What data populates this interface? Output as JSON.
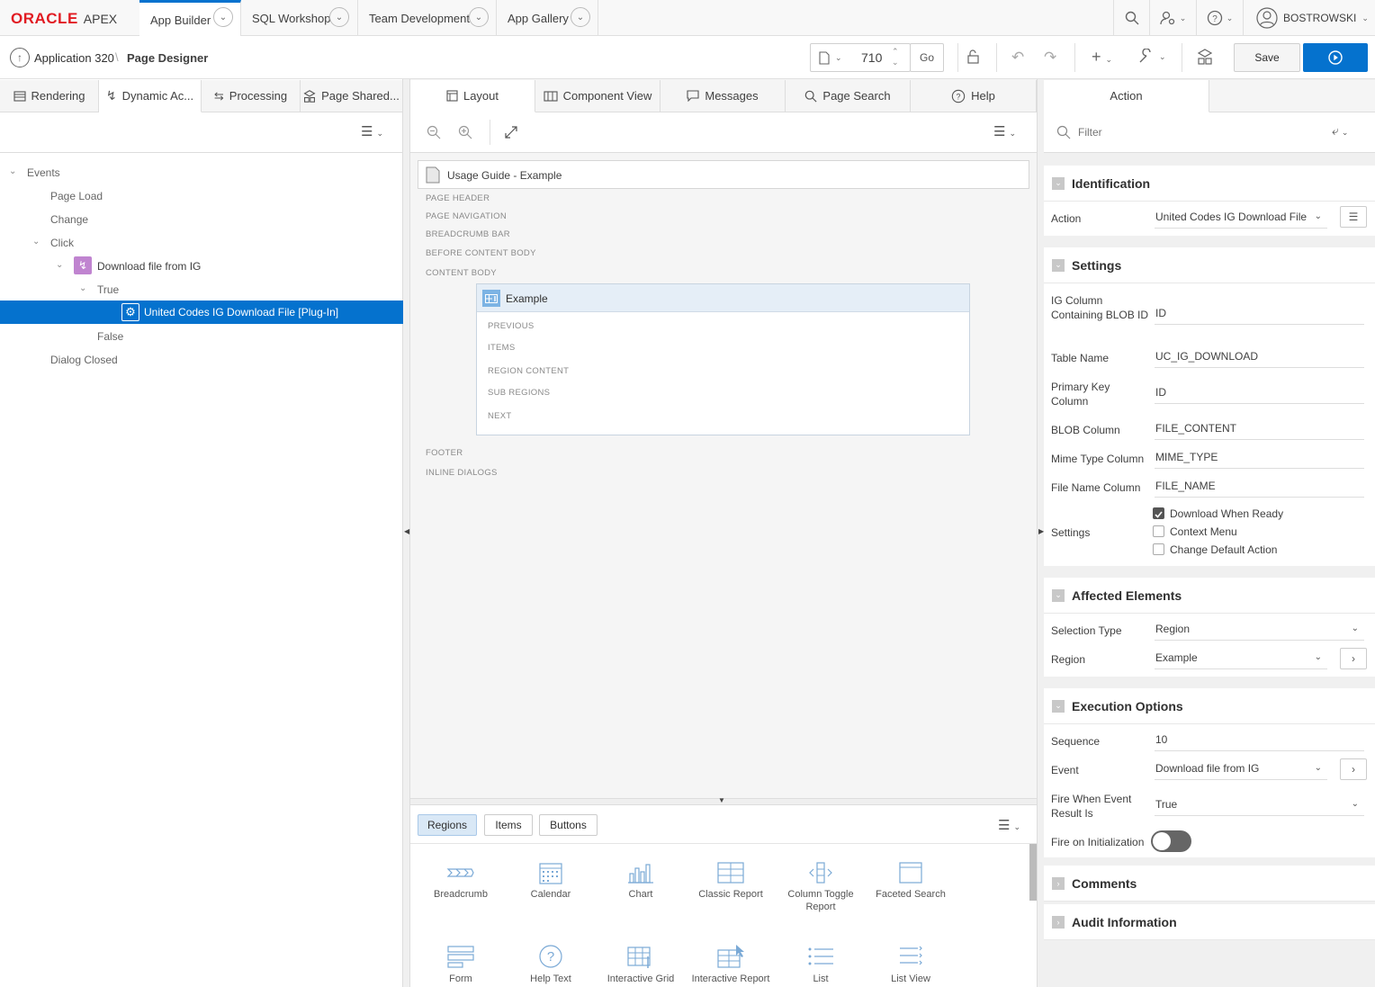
{
  "brand": {
    "oracle": "ORACLE",
    "apex": "APEX"
  },
  "nav": {
    "tabs": [
      "App Builder",
      "SQL Workshop",
      "Team Development",
      "App Gallery"
    ],
    "user": "BOSTROWSKI"
  },
  "toolbar": {
    "app": "Application 320",
    "page_designer": "Page Designer",
    "page_number": "710",
    "go": "Go",
    "save": "Save"
  },
  "left": {
    "tabs": [
      "Rendering",
      "Dynamic Ac...",
      "Processing",
      "Page Shared..."
    ],
    "tree": {
      "events": "Events",
      "page_load": "Page Load",
      "change": "Change",
      "click": "Click",
      "download": "Download file from IG",
      "true": "True",
      "plugin": "United Codes IG Download File [Plug-In]",
      "false": "False",
      "dialog_closed": "Dialog Closed"
    }
  },
  "center": {
    "tabs": [
      "Layout",
      "Component View",
      "Messages",
      "Page Search",
      "Help"
    ],
    "page_title": "Usage Guide - Example",
    "positions": [
      "PAGE HEADER",
      "PAGE NAVIGATION",
      "BREADCRUMB BAR",
      "BEFORE CONTENT BODY",
      "CONTENT BODY"
    ],
    "region": {
      "title": "Example",
      "slots": [
        "PREVIOUS",
        "ITEMS",
        "REGION CONTENT",
        "SUB REGIONS",
        "NEXT"
      ]
    },
    "positions_after": [
      "FOOTER",
      "INLINE DIALOGS"
    ],
    "gallery_tabs": [
      "Regions",
      "Items",
      "Buttons"
    ],
    "gallery": [
      {
        "label": "Breadcrumb",
        "icon": "breadcrumb-icon"
      },
      {
        "label": "Calendar",
        "icon": "calendar-icon"
      },
      {
        "label": "Chart",
        "icon": "chart-icon"
      },
      {
        "label": "Classic Report",
        "icon": "classic-report-icon"
      },
      {
        "label": "Column Toggle Report",
        "icon": "column-toggle-icon"
      },
      {
        "label": "Faceted Search",
        "icon": "faceted-search-icon"
      },
      {
        "label": "Form",
        "icon": "form-icon"
      },
      {
        "label": "Help Text",
        "icon": "help-text-icon"
      },
      {
        "label": "Interactive Grid",
        "icon": "interactive-grid-icon"
      },
      {
        "label": "Interactive Report",
        "icon": "interactive-report-icon"
      },
      {
        "label": "List",
        "icon": "list-icon"
      },
      {
        "label": "List View",
        "icon": "list-view-icon"
      }
    ]
  },
  "right": {
    "tab": "Action",
    "filter_placeholder": "Filter",
    "identification": {
      "title": "Identification",
      "action_label": "Action",
      "action_value": "United Codes IG Download File"
    },
    "settings": {
      "title": "Settings",
      "ig_column_label": "IG Column Containing BLOB ID",
      "ig_column_value": "ID",
      "table_label": "Table Name",
      "table_value": "UC_IG_DOWNLOAD",
      "pk_label": "Primary Key Column",
      "pk_value": "ID",
      "blob_label": "BLOB Column",
      "blob_value": "FILE_CONTENT",
      "mime_label": "Mime Type Column",
      "mime_value": "MIME_TYPE",
      "filename_label": "File Name Column",
      "filename_value": "FILE_NAME",
      "settings_label": "Settings",
      "opt1": "Download When Ready",
      "opt2": "Context Menu",
      "opt3": "Change Default Action"
    },
    "affected": {
      "title": "Affected Elements",
      "sel_label": "Selection Type",
      "sel_value": "Region",
      "region_label": "Region",
      "region_value": "Example"
    },
    "execution": {
      "title": "Execution Options",
      "seq_label": "Sequence",
      "seq_value": "10",
      "event_label": "Event",
      "event_value": "Download file from IG",
      "fire_label": "Fire When Event Result Is",
      "fire_value": "True",
      "init_label": "Fire on Initialization"
    },
    "comments": "Comments",
    "audit": "Audit Information"
  }
}
